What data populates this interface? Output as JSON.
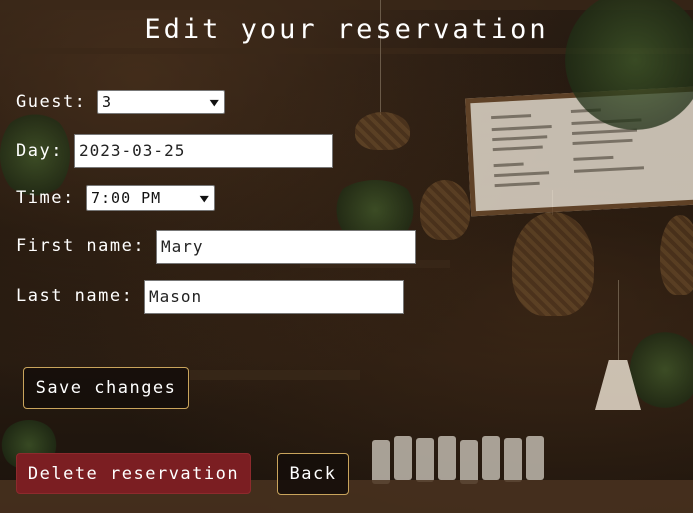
{
  "page": {
    "title": "Edit your reservation"
  },
  "form": {
    "guest": {
      "label": "Guest:",
      "value": "3"
    },
    "day": {
      "label": "Day:",
      "value": "2023-03-25"
    },
    "time": {
      "label": "Time:",
      "value": "7:00 PM"
    },
    "first_name": {
      "label": "First name:",
      "value": "Mary"
    },
    "last_name": {
      "label": "Last name:",
      "value": "Mason"
    }
  },
  "actions": {
    "save_label": "Save changes",
    "delete_label": "Delete reservation",
    "back_label": "Back"
  },
  "colors": {
    "button_border": "#c9a45c",
    "delete_bg": "#7b1e22",
    "text": "#ffffff"
  },
  "icons": {
    "select_arrow": "chevron-down-icon"
  }
}
